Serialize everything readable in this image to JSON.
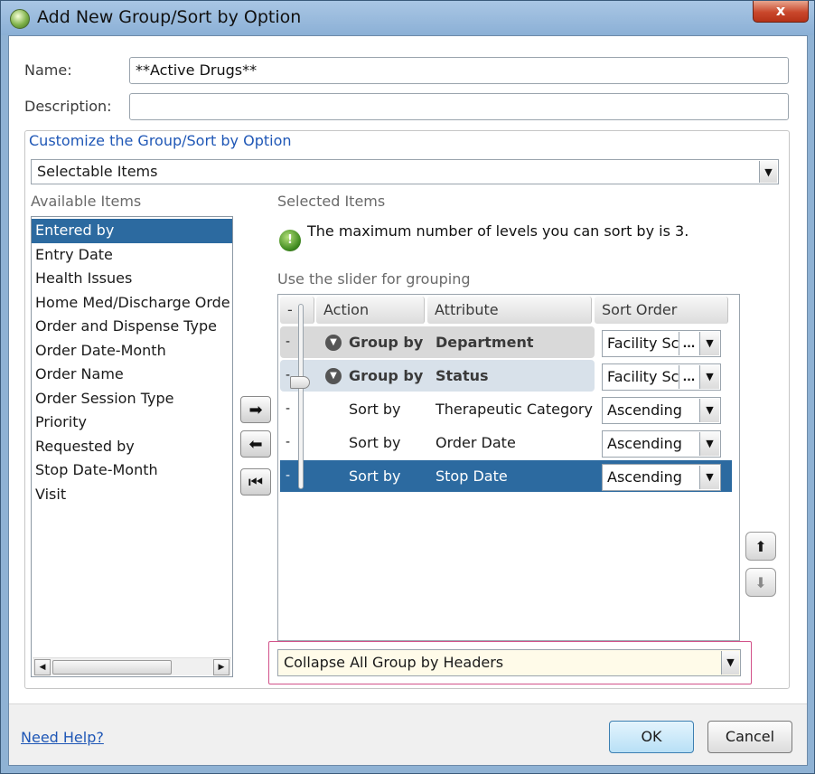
{
  "window": {
    "title": "Add New Group/Sort by Option",
    "close_label": "x"
  },
  "form": {
    "name_label": "Name:",
    "name_value": "**Active Drugs**",
    "description_label": "Description:",
    "description_value": ""
  },
  "customize": {
    "title": "Customize the Group/Sort by Option",
    "mode_selected": "Selectable Items"
  },
  "available": {
    "title": "Available Items",
    "items": [
      "Entered by",
      "Entry Date",
      "Health Issues",
      "Home Med/Discharge Orde",
      "Order and Dispense Type",
      "Order Date-Month",
      "Order Name",
      "Order Session Type",
      "Priority",
      "Requested by",
      "Stop Date-Month",
      "Visit"
    ],
    "selected_index": 0
  },
  "selected": {
    "title": "Selected Items",
    "info_message": "The maximum number of levels you can sort by is 3.",
    "slider_hint": "Use the slider for grouping",
    "columns": {
      "marker": "-",
      "action": "Action",
      "attribute": "Attribute",
      "sort_order": "Sort Order"
    },
    "rows": [
      {
        "marker": "-",
        "action": "Group by",
        "attribute": "Department",
        "sort_order": "Facility Sc",
        "type": "group"
      },
      {
        "marker": "-",
        "action": "Group by",
        "attribute": "Status",
        "sort_order": "Facility Sc",
        "type": "group"
      },
      {
        "marker": "-",
        "action": "Sort by",
        "attribute": "Therapeutic Category",
        "sort_order": "Ascending",
        "type": "sort"
      },
      {
        "marker": "-",
        "action": "Sort by",
        "attribute": "Order Date",
        "sort_order": "Ascending",
        "type": "sort"
      },
      {
        "marker": "-",
        "action": "Sort by",
        "attribute": "Stop Date",
        "sort_order": "Ascending",
        "type": "sort-selected"
      }
    ],
    "collapse_option": "Collapse All Group by Headers"
  },
  "icons": {
    "move_right": "arrow-right-icon",
    "move_left": "arrow-left-icon",
    "move_all_left": "first-icon",
    "move_up": "arrow-up-icon",
    "move_down": "arrow-down-icon",
    "info": "info-icon",
    "group": "chevron-down-circle-icon",
    "ellipsis": "..."
  },
  "footer": {
    "help_link": "Need Help?",
    "ok_label": "OK",
    "cancel_label": "Cancel"
  },
  "colors": {
    "accent": "#2c6aa0",
    "link": "#1f57b6",
    "focus_border": "#d2528a"
  }
}
